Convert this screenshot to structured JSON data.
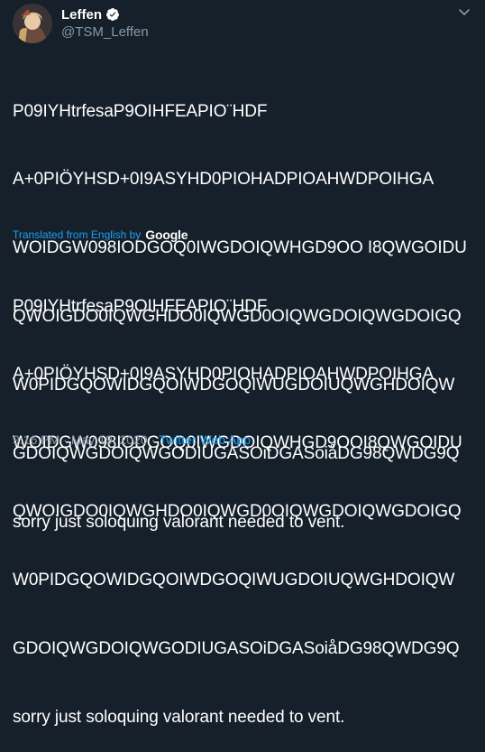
{
  "author": {
    "display_name": "Leffen",
    "handle": "@TSM_Leffen",
    "verified": true
  },
  "tweet": {
    "original_lines": [
      "P09IYHtrfesaP9OIHFEAPIO¨HDF",
      "A+0PIÖYHSD+0I9ASYHD0PIOHADPIOAHWDPOIHGA",
      "WOIDGW098IODGOQ0IWGDOIQWHGD9OO I8QWGOIDU",
      "QWOIGDO0IQWGHDO0IQWGD0OIQWGDOIQWGDOIGQ",
      "W0PIDGQOWIDGQOIWDGOQIWUGDOIUQWGHDOIQW",
      "GDOIQWGDOIQWGODIUGASOiDGASoiåDG98QWDG9Q",
      "sorry just soloquing valorant needed to vent."
    ],
    "translated_label": "Translated from English by",
    "translator": "Google",
    "translated_lines": [
      "P09IYHtrfesaP9OIHFEAPIO¨HDF",
      "A+0PIÖYHSD+0I9ASYHD0PIOHADPIOAHWDPOIHGA",
      "WOIDGW098IODGOQ0IWGDOIQWHGD9OOI8QWGOIDU",
      "QWOIGDO0IQWGHDO0IQWGD0OIQWGDOIQWGDOIGQ",
      "W0PIDGQOWIDGQOIWDGOQIWUGDOIUQWGHDOIQW",
      "GDOIQWGDOIQWGODIUGASOiDGASoiåDG98QWDG9Q",
      "sorry just soloquing valorant needed to vent."
    ],
    "time": "9:16 PM",
    "date": "May 19, 2020",
    "source": "Twitter Web App",
    "separator": "·"
  },
  "colors": {
    "background": "#15202b",
    "text": "#ffffff",
    "secondary": "#8899a6",
    "accent": "#1da1f2"
  },
  "icons": [
    "avatar",
    "verified-badge-icon",
    "chevron-down-icon"
  ]
}
